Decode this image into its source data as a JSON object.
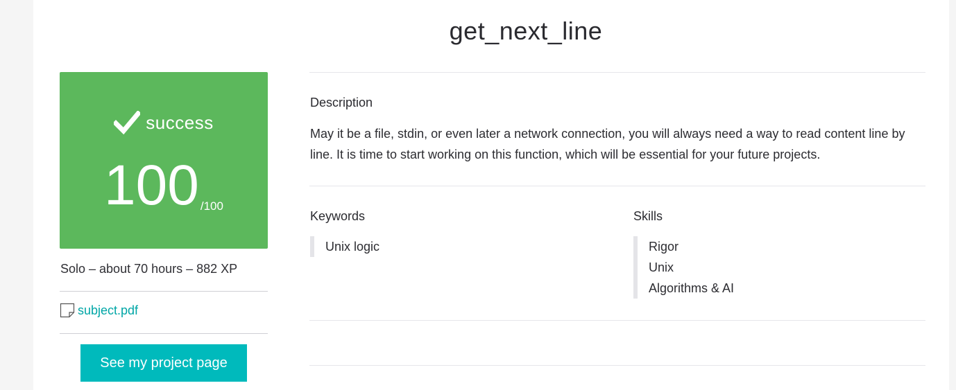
{
  "project": {
    "title": "get_next_line"
  },
  "result": {
    "status": "success",
    "score": "100",
    "max": "/100",
    "color": "#5cb85c"
  },
  "meta": "Solo – about 70 hours – 882 XP",
  "attachment": {
    "label": "subject.pdf",
    "icon": "document-icon"
  },
  "project_button": {
    "label": "See my project page",
    "color": "#00babc"
  },
  "description": {
    "label": "Description",
    "text": "May it be a file, stdin, or even later a network connection, you will always need a way to read content line by line. It is time to start working on this function, which will be essential for your future projects."
  },
  "keywords": {
    "label": "Keywords",
    "items": [
      "Unix logic"
    ]
  },
  "skills": {
    "label": "Skills",
    "items": [
      "Rigor",
      "Unix",
      "Algorithms & AI"
    ]
  }
}
